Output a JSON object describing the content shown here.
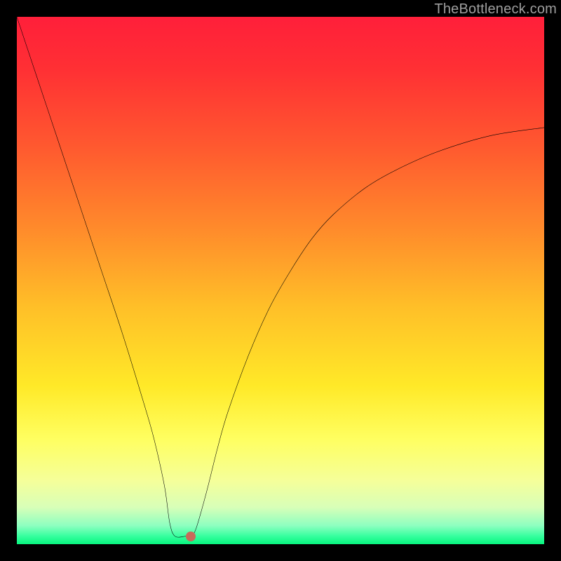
{
  "watermark": {
    "text": "TheBottleneck.com"
  },
  "colors": {
    "frame": "#000000",
    "curve": "#000000",
    "marker": "#c86a5a",
    "watermark": "#9f9f9f"
  },
  "chart_data": {
    "type": "line",
    "title": "",
    "xlabel": "",
    "ylabel": "",
    "xlim": [
      0,
      100
    ],
    "ylim": [
      0,
      100
    ],
    "gradient_stops": [
      {
        "pos": 0.0,
        "color": "#ff1f3a"
      },
      {
        "pos": 0.1,
        "color": "#ff3034"
      },
      {
        "pos": 0.25,
        "color": "#ff5a2f"
      },
      {
        "pos": 0.4,
        "color": "#ff8a2b"
      },
      {
        "pos": 0.55,
        "color": "#ffbf28"
      },
      {
        "pos": 0.7,
        "color": "#ffe928"
      },
      {
        "pos": 0.8,
        "color": "#ffff60"
      },
      {
        "pos": 0.88,
        "color": "#f5ff9a"
      },
      {
        "pos": 0.93,
        "color": "#d8ffb8"
      },
      {
        "pos": 0.965,
        "color": "#8dffc0"
      },
      {
        "pos": 0.985,
        "color": "#35ff9e"
      },
      {
        "pos": 1.0,
        "color": "#07f57e"
      }
    ],
    "series": [
      {
        "name": "bottleneck-curve",
        "x": [
          0.0,
          4.0,
          8.0,
          12.0,
          16.0,
          20.0,
          24.0,
          26.0,
          28.0,
          29.0,
          30.0,
          32.0,
          33.0,
          34.0,
          36.0,
          38.0,
          40.0,
          44.0,
          48.0,
          52.0,
          56.0,
          60.0,
          66.0,
          72.0,
          80.0,
          90.0,
          100.0
        ],
        "y": [
          100.0,
          88.0,
          76.0,
          64.0,
          52.0,
          40.0,
          27.0,
          20.0,
          11.0,
          4.0,
          1.5,
          1.5,
          1.5,
          3.0,
          10.0,
          18.0,
          25.0,
          36.0,
          45.0,
          52.0,
          58.0,
          62.5,
          67.5,
          71.0,
          74.5,
          77.5,
          79.0
        ]
      }
    ],
    "marker": {
      "x": 33.0,
      "y": 1.5
    }
  }
}
